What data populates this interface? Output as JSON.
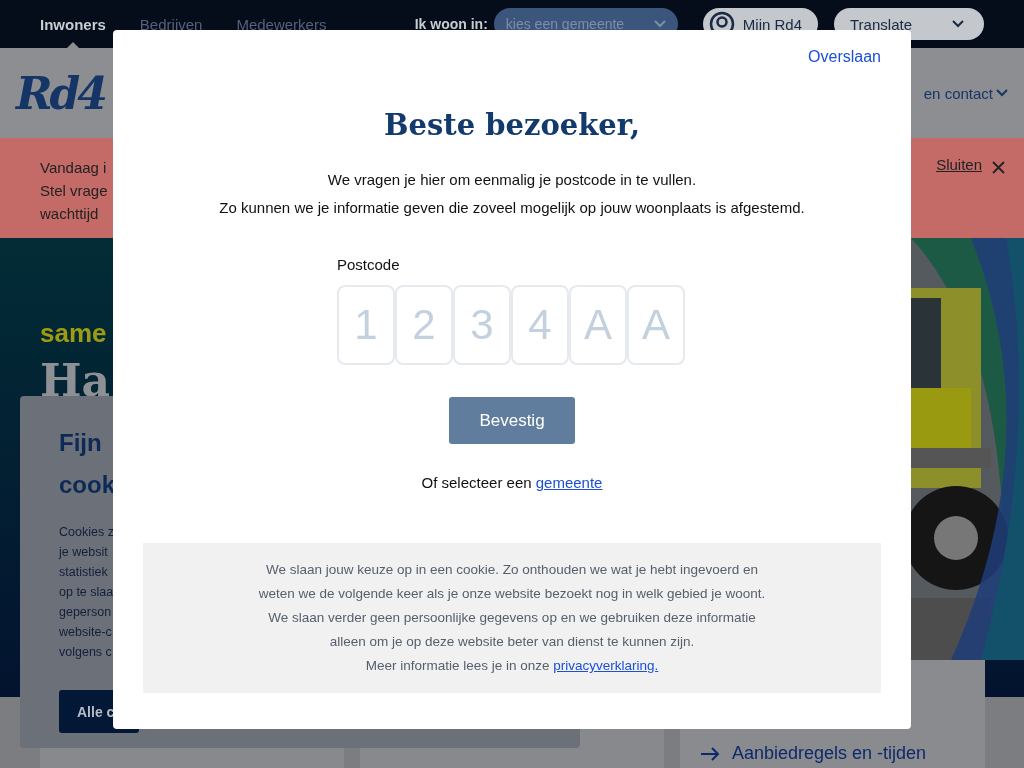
{
  "top_nav": {
    "tabs": [
      {
        "label": "Inwoners",
        "selected": true
      },
      {
        "label": "Bedrijven",
        "selected": false
      },
      {
        "label": "Medewerkers",
        "selected": false
      }
    ],
    "location_label": "Ik woon in:",
    "location_select": "kies een gemeente",
    "account": "Mijn Rd4",
    "translate": "Translate"
  },
  "header": {
    "logo": "Rd4",
    "menu_item": "en contact"
  },
  "alert": {
    "lines": [
      "Vandaag i",
      "Stel vrage",
      "wachttijd"
    ],
    "close": "Sluiten"
  },
  "hero": {
    "kicker": "same",
    "title": "Ha"
  },
  "cookie_card": {
    "title_lines": [
      "Fijn",
      "cook"
    ],
    "body_lines": [
      "Cookies z",
      "je websit",
      "statistiek",
      "op te slaa",
      "geperson",
      "website-c",
      "volgens c"
    ],
    "button": "Alle c"
  },
  "quick_link": "Aanbiedregels en -tijden",
  "modal": {
    "skip": "Overslaan",
    "title": "Beste bezoeker,",
    "intro": [
      "We vragen je hier om eenmalig je postcode in te vullen.",
      "Zo kunnen we je informatie geven die zoveel mogelijk op jouw woonplaats is afgestemd."
    ],
    "postcode": {
      "label": "Postcode",
      "boxes": [
        {
          "placeholder": "1"
        },
        {
          "placeholder": "2"
        },
        {
          "placeholder": "3"
        },
        {
          "placeholder": "4"
        },
        {
          "placeholder": "A"
        },
        {
          "placeholder": "A"
        }
      ]
    },
    "confirm": "Bevestig",
    "alt_text": "Of selecteer een",
    "alt_link": "gemeente",
    "notice": {
      "lines": [
        "We slaan jouw keuze op in een cookie. Zo onthouden we wat je hebt ingevoerd en",
        "weten we de volgende keer als je onze website bezoekt nog in welk gebied je woont.",
        "We slaan verder geen persoonlijke gegevens op en we gebruiken deze informatie",
        "alleen om je op deze website beter van dienst te kunnen zijn."
      ],
      "more": "Meer informatie lees je in onze",
      "link": "privacyverklaring."
    }
  }
}
